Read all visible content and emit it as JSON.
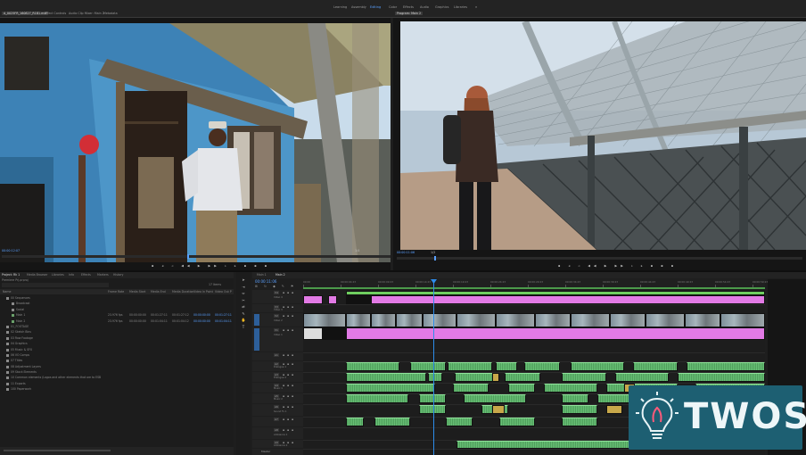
{
  "workspaces": [
    "Learning",
    "Assembly",
    "Editing",
    "Color",
    "Effects",
    "Audio",
    "Graphics",
    "Libraries"
  ],
  "source_tabs": [
    "A_0025FR_160827_R1B1.mxf",
    "Effect Controls",
    "Audio Clip Mixer: Main 2",
    "Metadata"
  ],
  "program_tab": "Program: Main 2",
  "source_tc_left": "00:00:12:07",
  "source_tc_right": "1/4",
  "program_tc_left": "00:00:11:06",
  "program_tc_right": "1/2",
  "project": {
    "tabs": [
      "Project: Rk 1",
      "Media Browser",
      "Libraries",
      "Info",
      "Effects",
      "Markers",
      "History"
    ],
    "name": "Premiere Prj.prproj",
    "count": "17 Items",
    "columns": [
      "Name",
      "Frame Rate",
      "Media Start",
      "Media End",
      "Media Duration",
      "Video In Point",
      "Video Out P"
    ],
    "items": [
      {
        "name": "00 Sequences",
        "rate": "",
        "start": "",
        "end": "",
        "dur": "",
        "vin": "",
        "vout": ""
      },
      {
        "name": "Broadcast",
        "rate": "",
        "start": "",
        "end": "",
        "dur": "",
        "vin": "",
        "vout": ""
      },
      {
        "name": "Social",
        "rate": "",
        "start": "",
        "end": "",
        "dur": "",
        "vin": "",
        "vout": ""
      },
      {
        "name": "Main 1",
        "rate": "23.976 fps",
        "start": "00:00:00:00",
        "end": "00:01:27:11",
        "dur": "00:01:27:12",
        "vin": "00:00:00:00",
        "vout": "00:01:27:11"
      },
      {
        "name": "Main 2",
        "rate": "23.976 fps",
        "start": "00:00:00:00",
        "end": "00:01:04:11",
        "dur": "00:01:04:12",
        "vin": "00:00:00:00",
        "vout": "00:01:04:11"
      },
      {
        "name": "01_FOOTAGE",
        "rate": "",
        "start": "",
        "end": "",
        "dur": "",
        "vin": "",
        "vout": ""
      },
      {
        "name": "02 Sketch Bins",
        "rate": "",
        "start": "",
        "end": "",
        "dur": "",
        "vin": "",
        "vout": ""
      },
      {
        "name": "03 Raw Footage",
        "rate": "",
        "start": "",
        "end": "",
        "dur": "",
        "vin": "",
        "vout": ""
      },
      {
        "name": "04 Graphics",
        "rate": "",
        "start": "",
        "end": "",
        "dur": "",
        "vin": "",
        "vout": ""
      },
      {
        "name": "05 Music & SFX",
        "rate": "",
        "start": "",
        "end": "",
        "dur": "",
        "vin": "",
        "vout": ""
      },
      {
        "name": "06 VO Comps",
        "rate": "",
        "start": "",
        "end": "",
        "dur": "",
        "vin": "",
        "vout": ""
      },
      {
        "name": "07 Titles",
        "rate": "",
        "start": "",
        "end": "",
        "dur": "",
        "vin": "",
        "vout": ""
      },
      {
        "name": "08 Adjustment Layers",
        "rate": "",
        "start": "",
        "end": "",
        "dur": "",
        "vin": "",
        "vout": ""
      },
      {
        "name": "09 Stock Elements",
        "rate": "",
        "start": "",
        "end": "",
        "dur": "",
        "vin": "",
        "vout": ""
      },
      {
        "name": "10 Common elements (Logos and other elements that are to ESB",
        "rate": "",
        "start": "",
        "end": "",
        "dur": "",
        "vin": "",
        "vout": ""
      },
      {
        "name": "11 Exports",
        "rate": "",
        "start": "",
        "end": "",
        "dur": "",
        "vin": "",
        "vout": ""
      },
      {
        "name": "100 Paperwork",
        "rate": "",
        "start": "",
        "end": "",
        "dur": "",
        "vin": "",
        "vout": ""
      }
    ]
  },
  "timeline": {
    "tabs": [
      "Main 1",
      "Main 2"
    ],
    "timecode": "00:00:11:06",
    "ruler": [
      "00:00",
      "00:00:04:23",
      "00:00:09:23",
      "00:00:14:23",
      "00:00:19:23",
      "00:00:24:23",
      "00:00:29:23",
      "00:00:34:23",
      "00:00:39:23",
      "00:00:44:23",
      "00:00:49:23",
      "00:00:54:23",
      "00:00:59:23"
    ],
    "video_tracks": [
      "V4",
      "V3",
      "V2",
      "V1"
    ],
    "audio_tracks": [
      "A1",
      "A2",
      "A3",
      "A4",
      "A5",
      "A6",
      "A7",
      "A8",
      "A9"
    ],
    "track_names": [
      "Video 4",
      "Video 3",
      "Video 2",
      "Video 1",
      "",
      "Dialogue 1",
      "Dialogue 2",
      "Music 1",
      "Music 2",
      "Sound Fx 1",
      "",
      "Ambience 1",
      "Ambience 2"
    ],
    "master": "Master"
  },
  "watermark": "TWOS",
  "colors": {
    "accent": "#2d8ceb",
    "pink": "#e27ae5",
    "video_blue": "#8cb4ff",
    "audio_green": "#5bb66a"
  }
}
